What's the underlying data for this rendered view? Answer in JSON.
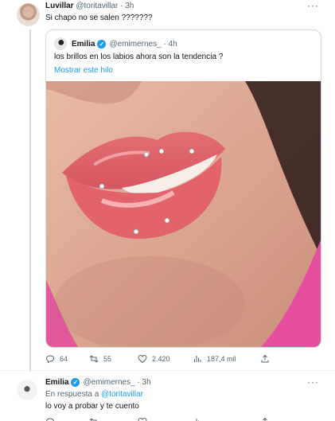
{
  "main_tweet": {
    "name": "Luvillar",
    "handle": "@toritavillar",
    "time": "3h",
    "text": "Si chapo no se salen ???????",
    "more": "···"
  },
  "quoted_tweet": {
    "name": "Emilia",
    "handle": "@emimernes_",
    "time": "4h",
    "text": "los brillos en los labios ahora son la tendencia ?",
    "show_thread": "Mostrar este hilo"
  },
  "actions": {
    "replies": "64",
    "retweets": "55",
    "likes": "2.420",
    "views": "187,4 mil"
  },
  "reply_tweet": {
    "name": "Emilia",
    "handle": "@emimernes_",
    "time": "3h",
    "reply_prefix": "En respuesta a",
    "reply_mention": "@toritavillar",
    "text": "lo voy a probar y te cuento",
    "more": "···"
  },
  "colors": {
    "accent": "#1d9bf0",
    "muted": "#536471",
    "border": "#cfd9de"
  }
}
